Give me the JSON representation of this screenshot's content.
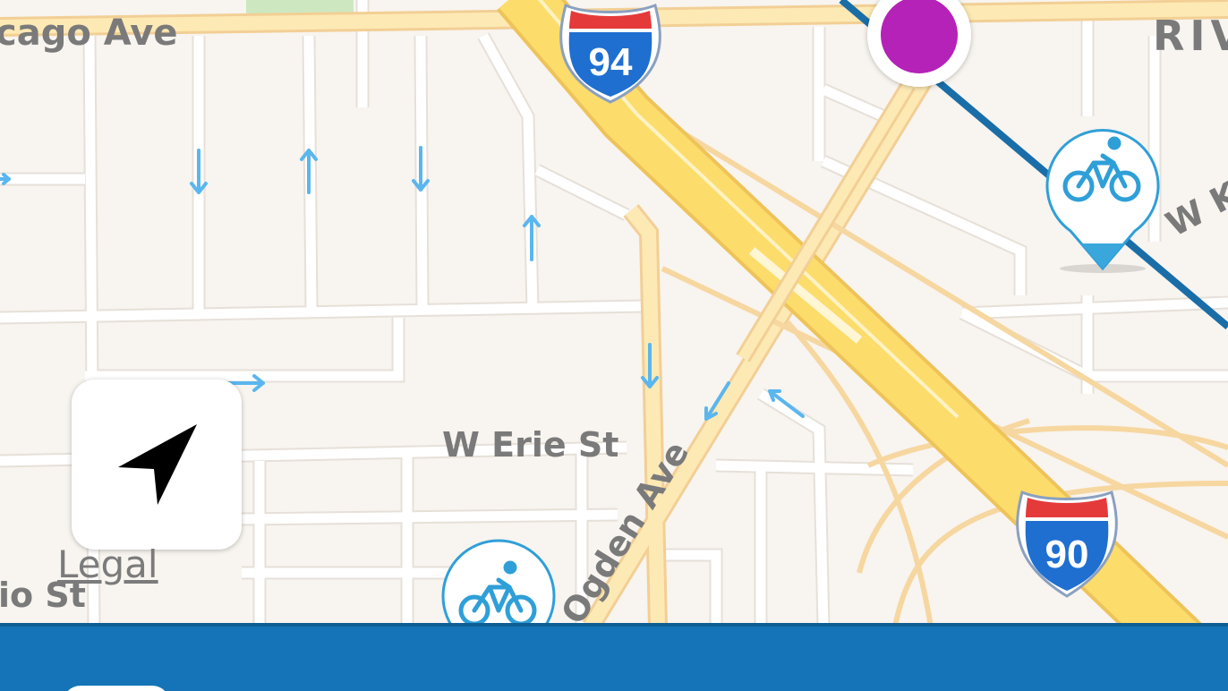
{
  "map": {
    "street_labels": {
      "chicago_ave": "cago Ave",
      "erie_st": "W Erie St",
      "ogden_ave": "Ogden Ave",
      "ontario_st": "io St",
      "w_k": "W K",
      "river_west": "RIV"
    },
    "highways": {
      "i94": "94",
      "i90": "90"
    },
    "markers": {
      "station": "purple-station-marker",
      "bike_share_primary": "bike-share-icon",
      "bike_share_secondary": "bike-share-icon"
    },
    "colors": {
      "land": "#f8f4ef",
      "street": "#ffffff",
      "street_outline": "#e6e0d8",
      "highway": "#fcdc6b",
      "arterial": "#fde9b4",
      "transit_line": "#1a6ea8",
      "station": "#b522b8",
      "bike": "#2f9fd8",
      "one_way_arrow": "#5ab6ee",
      "interstate_blue": "#1f6fd1",
      "interstate_red": "#e53a3a"
    }
  },
  "controls": {
    "locate_icon": "navigation-arrow-icon",
    "legal_label": "Legal"
  },
  "bottom_bar": {
    "color": "#1474b7"
  }
}
